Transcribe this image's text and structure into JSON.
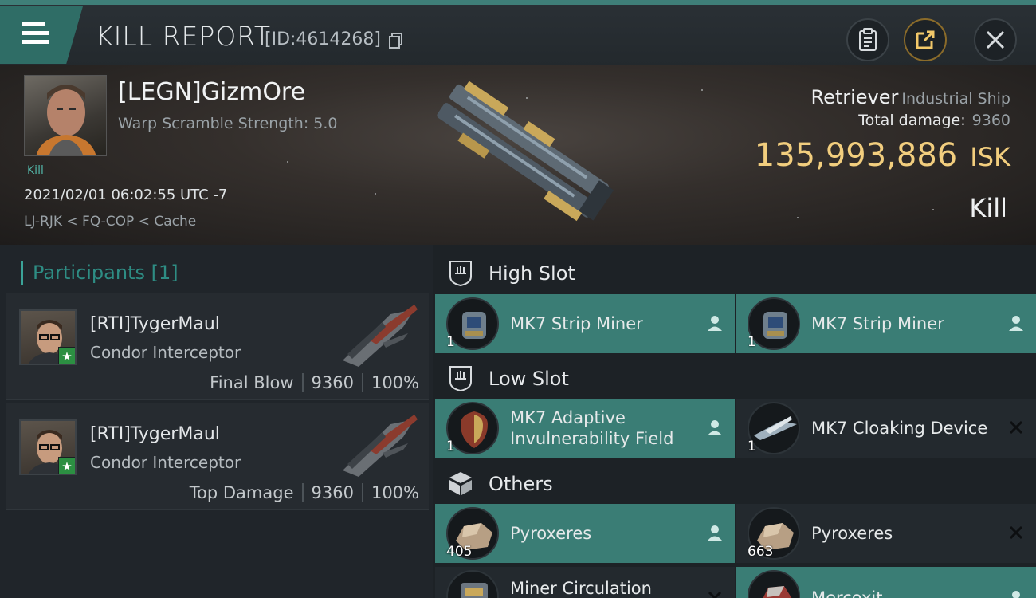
{
  "header": {
    "title": "KILL REPORT",
    "report_id": "[ID:4614268]"
  },
  "victim": {
    "name": "[LEGN]GizmOre",
    "warp_scramble": "Warp Scramble Strength: 5.0",
    "kill_tag": "Kill",
    "datetime": "2021/02/01 06:02:55 UTC -7",
    "location": "LJ-RJK < FQ-COP < Cache",
    "ship_name": "Retriever",
    "ship_class": "Industrial Ship",
    "total_damage_label": "Total damage:",
    "total_damage": "9360",
    "isk_value": "135,993,886",
    "isk_unit": "ISK",
    "result": "Kill"
  },
  "participants": {
    "header": "Participants [1]",
    "rows": [
      {
        "name": "[RTI]TygerMaul",
        "ship": "Condor Interceptor",
        "role": "Final Blow",
        "damage": "9360",
        "percent": "100%"
      },
      {
        "name": "[RTI]TygerMaul",
        "ship": "Condor Interceptor",
        "role": "Top Damage",
        "damage": "9360",
        "percent": "100%"
      }
    ]
  },
  "fittings": {
    "high_slot": {
      "title": "High Slot",
      "items": [
        {
          "name": "MK7 Strip Miner",
          "qty": "1",
          "status": "dropped"
        },
        {
          "name": "MK7 Strip Miner",
          "qty": "1",
          "status": "dropped"
        }
      ]
    },
    "low_slot": {
      "title": "Low Slot",
      "items": [
        {
          "name": "MK7 Adaptive Invulnerability Field",
          "qty": "1",
          "status": "dropped"
        },
        {
          "name": "MK7 Cloaking Device",
          "qty": "1",
          "status": "destroyed"
        }
      ]
    },
    "others": {
      "title": "Others",
      "items": [
        {
          "name": "Pyroxeres",
          "qty": "405",
          "status": "dropped"
        },
        {
          "name": "Pyroxeres",
          "qty": "663",
          "status": "destroyed"
        },
        {
          "name": "Miner Circulation",
          "qty": "",
          "status": "destroyed"
        },
        {
          "name": "Mercoxit",
          "qty": "",
          "status": "dropped"
        }
      ]
    }
  },
  "colors": {
    "accent": "#3a7d75",
    "isk": "#f2ce7e",
    "kill_tag": "#52b3a6"
  },
  "icons": {
    "menu": "hamburger-icon",
    "copy": "copy-icon",
    "clipboard": "clipboard-icon",
    "share": "share-icon",
    "close": "close-icon",
    "dropped": "person-icon",
    "destroyed": "x-icon"
  }
}
